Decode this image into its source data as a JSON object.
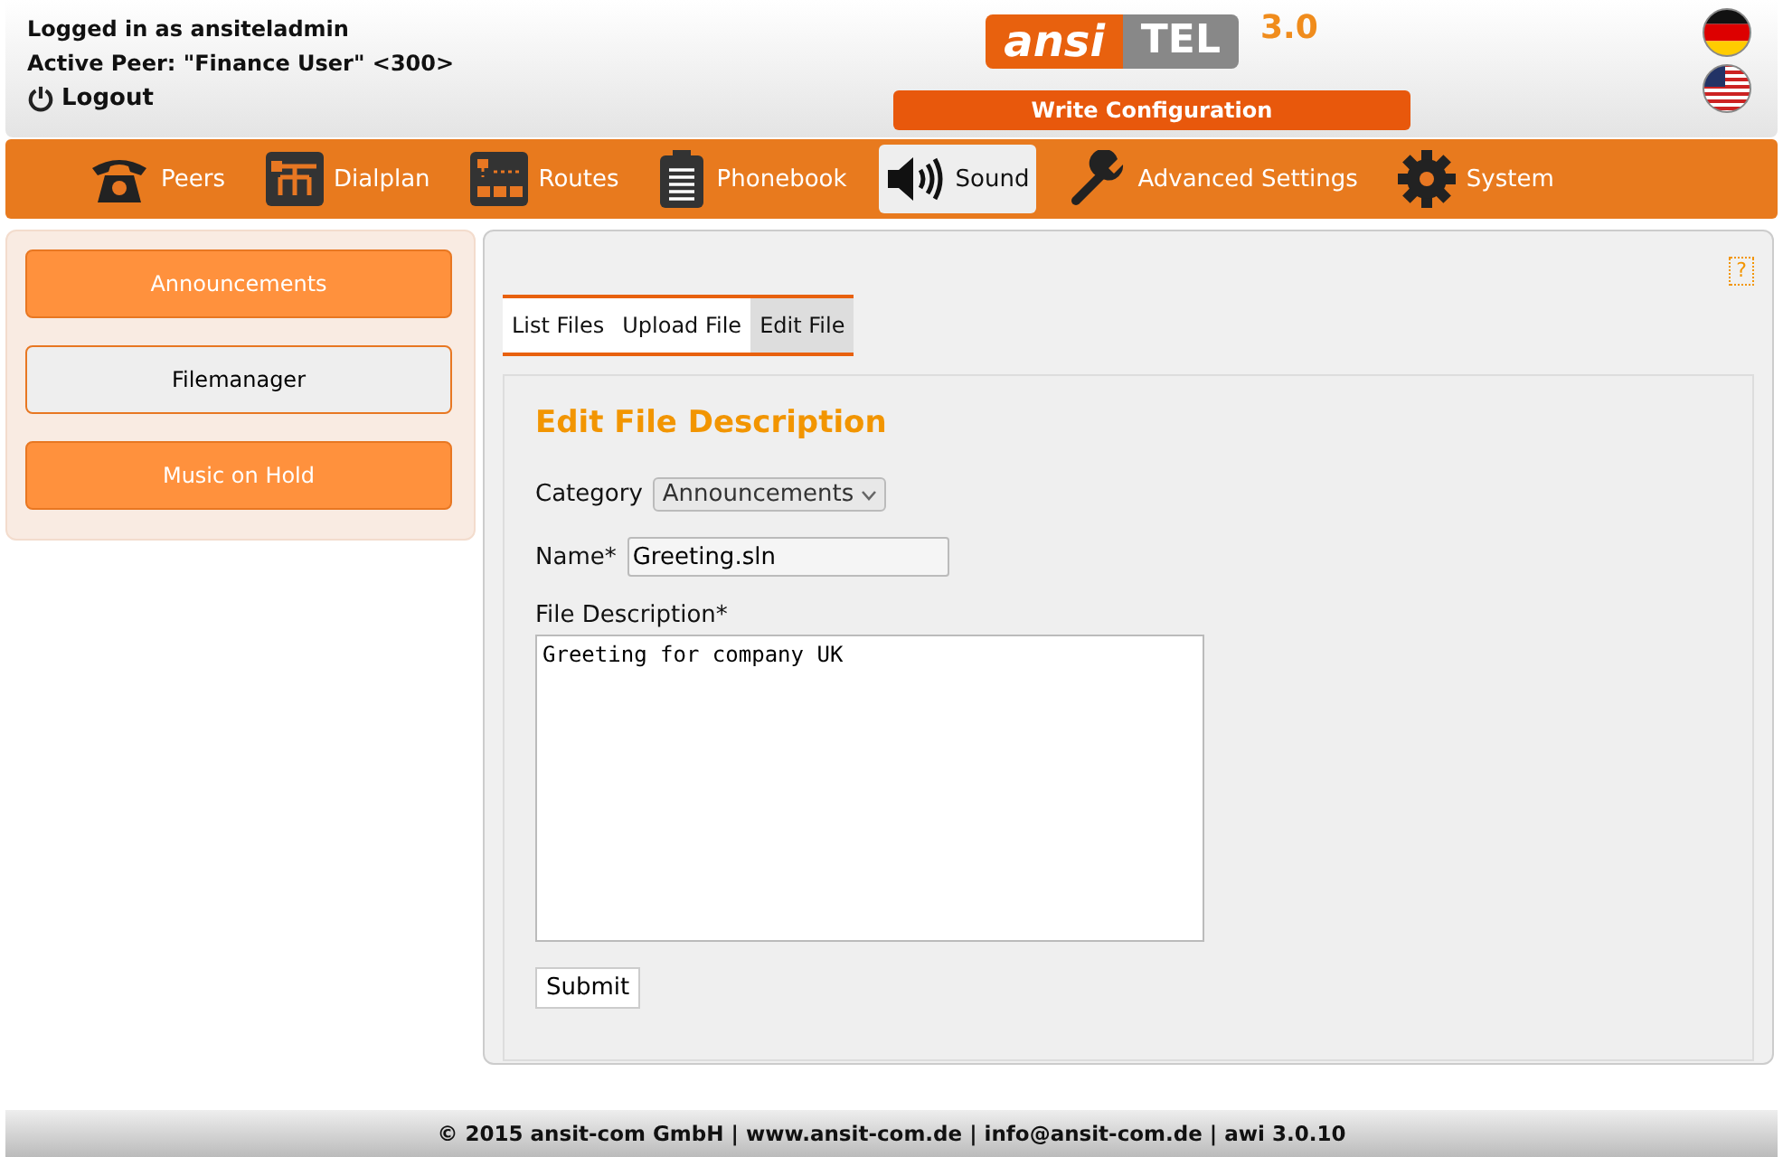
{
  "header": {
    "user_line": "Logged in as ansiteladmin",
    "peer_line": "Active Peer: \"Finance User\" <300>",
    "logout": "Logout",
    "logo": {
      "left": "ansi",
      "right": "TEL",
      "version": "3.0"
    },
    "write_button": "Write Configuration",
    "languages": [
      {
        "kind": "german"
      },
      {
        "kind": "usa"
      }
    ]
  },
  "nav": [
    {
      "label": "Peers",
      "kind": "phone",
      "selected": false
    },
    {
      "label": "Dialplan",
      "kind": "dialplan",
      "selected": false
    },
    {
      "label": "Routes",
      "kind": "routes",
      "selected": false
    },
    {
      "label": "Phonebook",
      "kind": "phonebook",
      "selected": false
    },
    {
      "label": "Sound",
      "kind": "speaker",
      "selected": true
    },
    {
      "label": "Advanced Settings",
      "kind": "wrench",
      "selected": false
    },
    {
      "label": "System",
      "kind": "gear",
      "selected": false
    }
  ],
  "sidebar": {
    "items": [
      {
        "label": "Announcements",
        "selected": false
      },
      {
        "label": "Filemanager",
        "selected": true
      },
      {
        "label": "Music on Hold",
        "selected": false
      }
    ]
  },
  "content": {
    "help": "?",
    "tabs": [
      {
        "label": "List Files",
        "selected": false
      },
      {
        "label": "Upload File",
        "selected": false
      },
      {
        "label": "Edit File",
        "selected": true
      }
    ],
    "form": {
      "title": "Edit File Description",
      "category_label": "Category",
      "category_value": "Announcements",
      "name_label": "Name*",
      "name_value": "Greeting.sln",
      "description_label": "File Description*",
      "description_value": "Greeting for company UK",
      "submit": "Submit"
    }
  },
  "footer": "© 2015 ansit-com GmbH | www.ansit-com.de | info@ansit-com.de | awi 3.0.10"
}
